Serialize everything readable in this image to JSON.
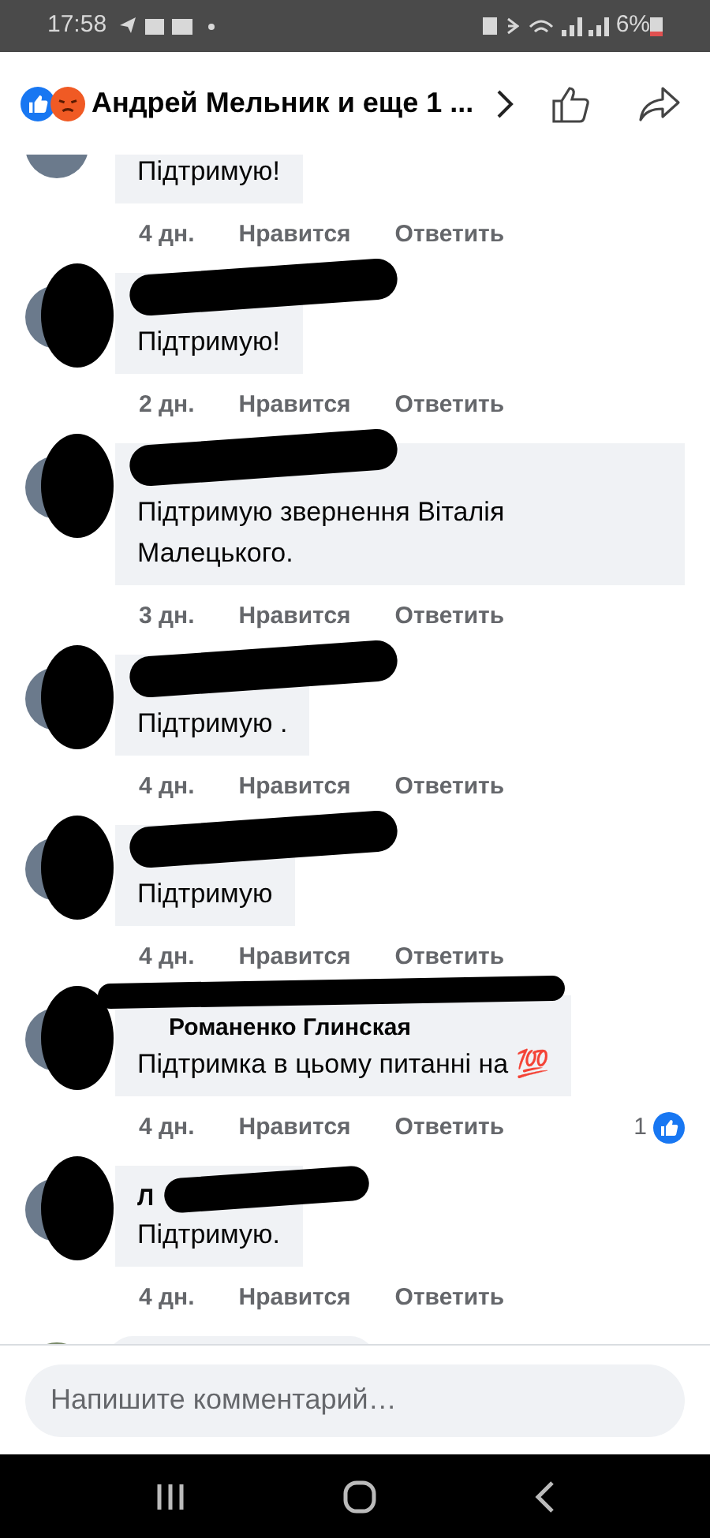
{
  "status_bar": {
    "time": "17:58",
    "battery": "6%"
  },
  "header": {
    "title": "Андрей Мельник и еще 1 ..."
  },
  "comments": [
    {
      "kind": "comment",
      "text": "Підтримую!",
      "time": "4 дн.",
      "like": "Нравится",
      "reply": "Ответить"
    },
    {
      "kind": "comment",
      "name_redacted": true,
      "text": "Підтримую!",
      "time": "2 дн.",
      "like": "Нравится",
      "reply": "Ответить"
    },
    {
      "kind": "comment",
      "name_redacted": true,
      "text": "Підтримую звернення Віталія Малецького.",
      "time": "3 дн.",
      "like": "Нравится",
      "reply": "Ответить"
    },
    {
      "kind": "comment",
      "name_redacted": true,
      "text": "Підтримую .",
      "time": "4 дн.",
      "like": "Нравится",
      "reply": "Ответить"
    },
    {
      "kind": "comment",
      "name_redacted": true,
      "text": "Підтримую",
      "time": "4 дн.",
      "like": "Нравится",
      "reply": "Ответить"
    },
    {
      "kind": "comment",
      "name_redacted": true,
      "author": "Романенко Глинская",
      "text": "Підтримка в цьому питанні на 💯",
      "time": "4 дн.",
      "like": "Нравится",
      "reply": "Ответить",
      "reactions": "1"
    },
    {
      "kind": "comment",
      "name_redacted": true,
      "author": "Л",
      "text": "Підтримую.",
      "time": "4 дн.",
      "like": "Нравится",
      "reply": "Ответить"
    },
    {
      "kind": "partial"
    }
  ],
  "composer": {
    "placeholder": "Напишите комментарий…"
  }
}
